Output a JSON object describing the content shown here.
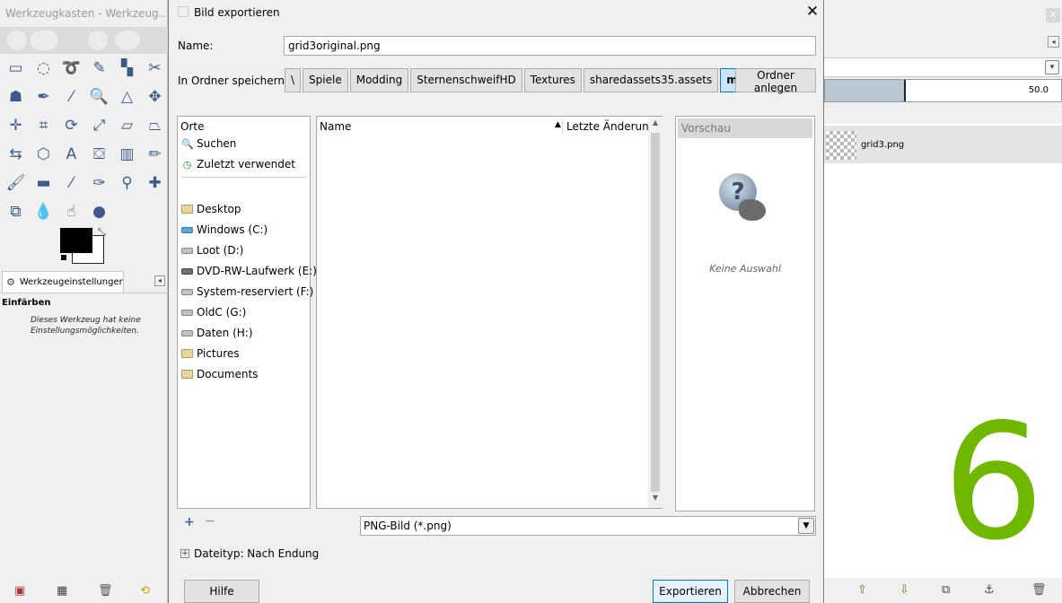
{
  "toolbox": {
    "title": "Werkzeugkasten - Werkzeug...",
    "close": "×",
    "tab_label": "Werkzeugeinstellungen",
    "tool_name": "Einfärben",
    "tool_description": "Dieses Werkzeug hat keine Einstellungsmöglichkeiten.",
    "tools": [
      {
        "name": "rect-select-icon",
        "glyph": "▭"
      },
      {
        "name": "ellipse-select-icon",
        "glyph": "◌"
      },
      {
        "name": "free-select-icon",
        "glyph": "➰"
      },
      {
        "name": "fuzzy-select-icon",
        "glyph": "✎"
      },
      {
        "name": "color-select-icon",
        "glyph": "▚"
      },
      {
        "name": "scissors-select-icon",
        "glyph": "✂"
      },
      {
        "name": "foreground-select-icon",
        "glyph": "☗"
      },
      {
        "name": "paths-icon",
        "glyph": "✒"
      },
      {
        "name": "color-picker-icon",
        "glyph": "⁄"
      },
      {
        "name": "zoom-icon",
        "glyph": "🔍"
      },
      {
        "name": "measure-icon",
        "glyph": "△"
      },
      {
        "name": "move-icon",
        "glyph": "✥"
      },
      {
        "name": "align-icon",
        "glyph": "✛"
      },
      {
        "name": "crop-icon",
        "glyph": "⌗"
      },
      {
        "name": "rotate-icon",
        "glyph": "⟳"
      },
      {
        "name": "scale-icon",
        "glyph": "⤢"
      },
      {
        "name": "shear-icon",
        "glyph": "▱"
      },
      {
        "name": "perspective-icon",
        "glyph": "⏢"
      },
      {
        "name": "flip-icon",
        "glyph": "⇆"
      },
      {
        "name": "cage-icon",
        "glyph": "⬡"
      },
      {
        "name": "text-icon",
        "glyph": "A"
      },
      {
        "name": "bucket-fill-icon",
        "glyph": "⛋"
      },
      {
        "name": "blend-icon",
        "glyph": "▥"
      },
      {
        "name": "pencil-icon",
        "glyph": "✏"
      },
      {
        "name": "paintbrush-icon",
        "glyph": "🖌"
      },
      {
        "name": "eraser-icon",
        "glyph": "▬"
      },
      {
        "name": "airbrush-icon",
        "glyph": "⁄"
      },
      {
        "name": "ink-icon",
        "glyph": "✑"
      },
      {
        "name": "clone-icon",
        "glyph": "⚲"
      },
      {
        "name": "heal-icon",
        "glyph": "✚"
      },
      {
        "name": "perspective-clone-icon",
        "glyph": "⧉"
      },
      {
        "name": "blur-icon",
        "glyph": "💧"
      },
      {
        "name": "smudge-icon",
        "glyph": "☝"
      },
      {
        "name": "dodge-burn-icon",
        "glyph": "●"
      }
    ]
  },
  "image_window": {
    "slider_value": "50.0",
    "slider_fraction": 0.333,
    "layer_name": "grid3.png",
    "overlay_number": "6"
  },
  "dialog": {
    "title": "Bild exportieren",
    "close": "✕",
    "name_label": "Name:",
    "name_value": "grid3original.png",
    "folder_label": "In Ordner speichern:",
    "breadcrumbs": [
      "\\",
      "Spiele",
      "Modding",
      "SternenschweifHD",
      "Textures",
      "sharedassets35.assets",
      "mittel"
    ],
    "create_folder": "Ordner anlegen",
    "places_header": "Orte",
    "places_top": [
      {
        "label": "Suchen",
        "icon": "search-icon"
      },
      {
        "label": "Zuletzt verwendet",
        "icon": "recent-icon"
      }
    ],
    "places": [
      {
        "label": "Desktop",
        "icon": "folder"
      },
      {
        "label": "Windows (C:)",
        "icon": "win"
      },
      {
        "label": "Loot (D:)",
        "icon": "drive"
      },
      {
        "label": "DVD-RW-Laufwerk (E:)",
        "icon": "dvd"
      },
      {
        "label": "System-reserviert (F:)",
        "icon": "drive"
      },
      {
        "label": "OldC (G:)",
        "icon": "drive"
      },
      {
        "label": "Daten (H:)",
        "icon": "drive"
      },
      {
        "label": "Pictures",
        "icon": "folder"
      },
      {
        "label": "Documents",
        "icon": "folder"
      }
    ],
    "col_name": "Name",
    "col_date": "Letzte Änderung",
    "preview_header": "Vorschau",
    "preview_empty": "Keine Auswahl",
    "filetype_value": "PNG-Bild (*.png)",
    "expander_label": "Dateityp: Nach Endung",
    "help_button": "Hilfe",
    "export_button": "Exportieren",
    "cancel_button": "Abbrechen"
  }
}
